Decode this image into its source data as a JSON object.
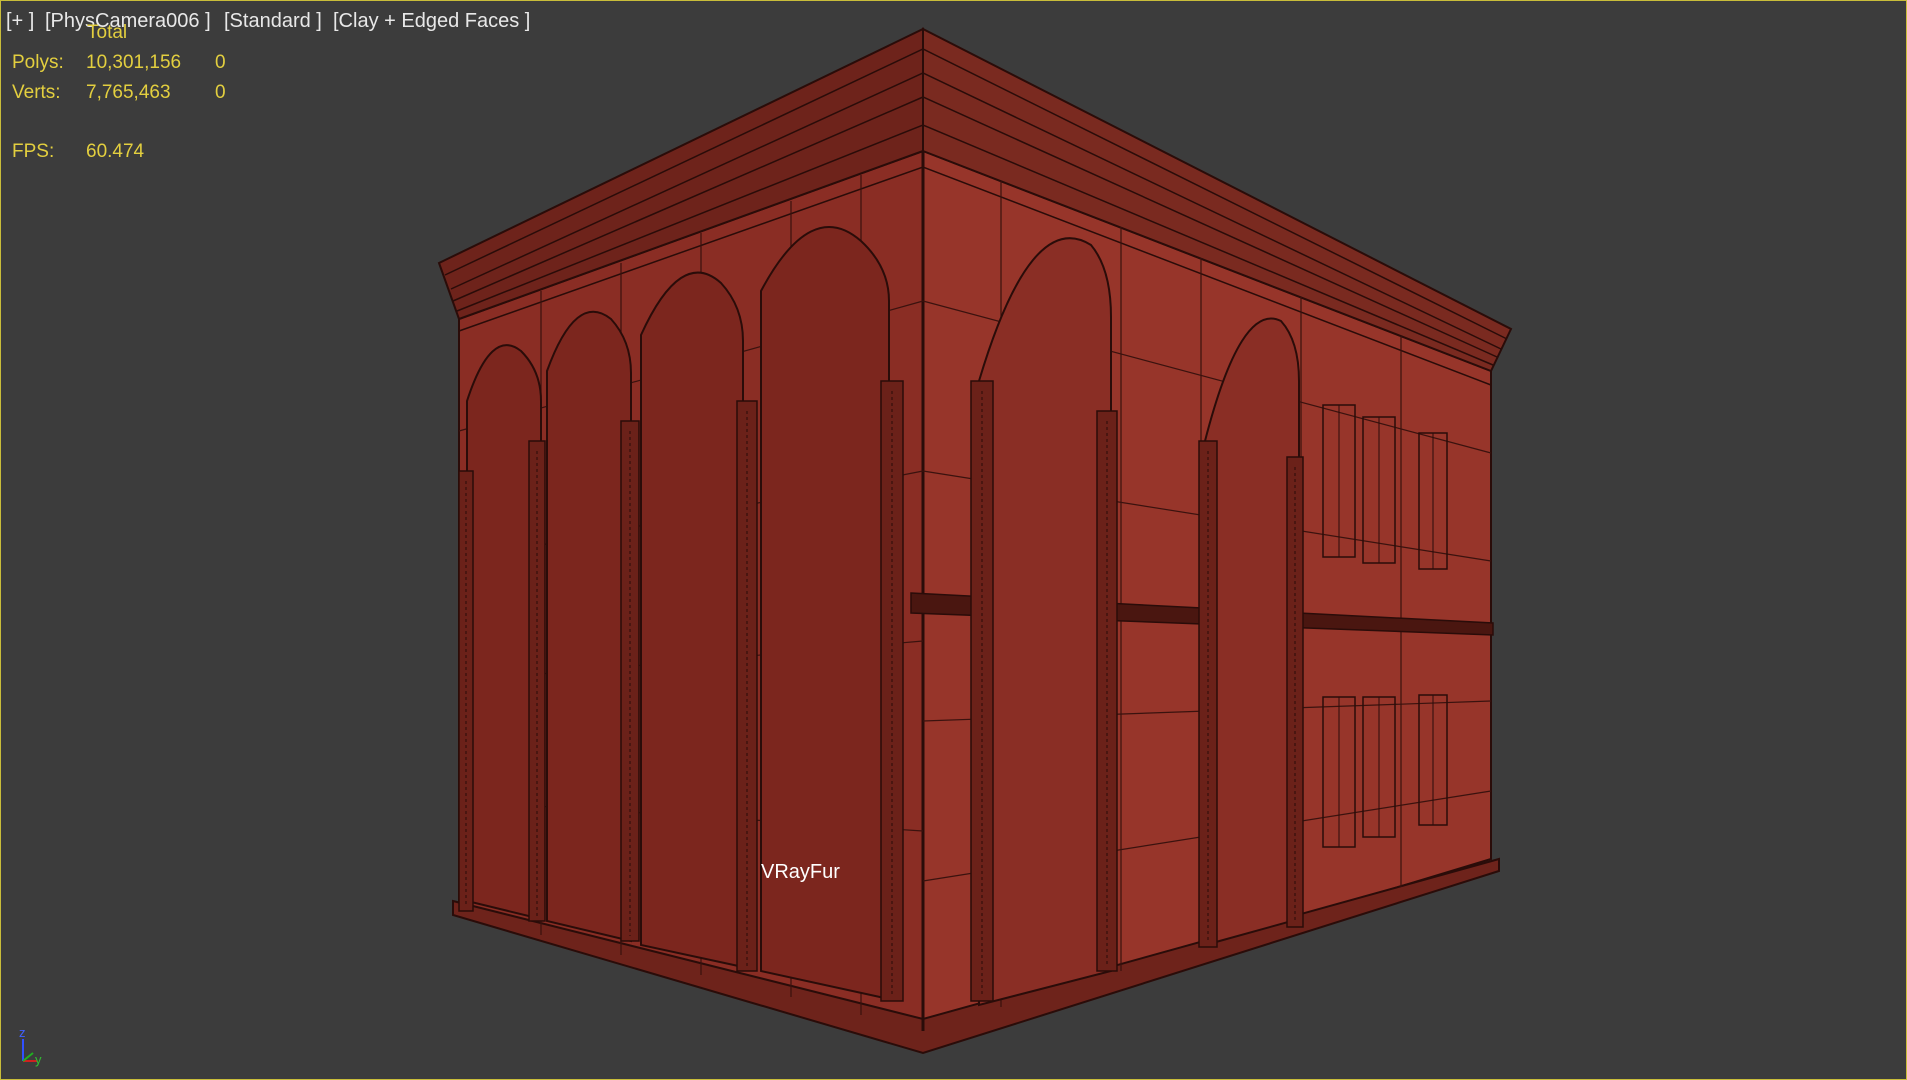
{
  "viewport": {
    "labels": {
      "plus": "[+ ]",
      "camera": "[PhysCamera006 ]",
      "shading": "[Standard ]",
      "mode": "[Clay + Edged Faces ]"
    },
    "stats": {
      "total_header": "Total",
      "polys_label": "Polys:",
      "polys_value": "10,301,156",
      "polys_selected": "0",
      "verts_label": "Verts:",
      "verts_value": "7,765,463",
      "verts_selected": "0",
      "fps_label": "FPS:",
      "fps_value": "60.474"
    },
    "object_label": "VRayFur",
    "axis": {
      "z": "z",
      "y": "y"
    },
    "colors": {
      "background": "#3c3c3c",
      "border": "#c9bd3a",
      "stats_text": "#e3cf3f",
      "building_front": "#8a2d24",
      "building_side": "#97352a",
      "edges": "#2a0c09"
    }
  }
}
